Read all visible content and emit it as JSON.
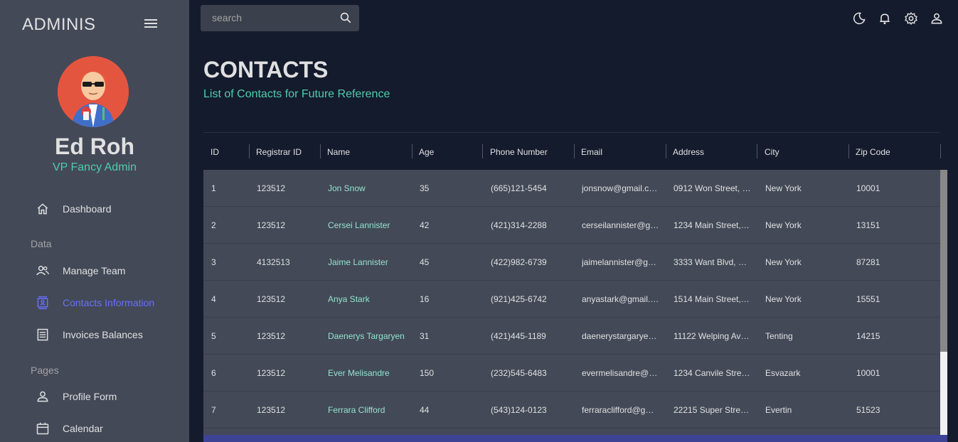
{
  "sidebar": {
    "brand": "ADMINIS",
    "user": {
      "name": "Ed Roh",
      "role": "VP Fancy Admin"
    },
    "items": [
      {
        "label": "Dashboard",
        "icon": "home-icon"
      },
      {
        "label": "Manage Team",
        "icon": "team-icon"
      },
      {
        "label": "Contacts Information",
        "icon": "contacts-icon",
        "active": true
      },
      {
        "label": "Invoices Balances",
        "icon": "receipt-icon"
      },
      {
        "label": "Profile Form",
        "icon": "person-icon"
      },
      {
        "label": "Calendar",
        "icon": "calendar-icon"
      }
    ],
    "sections": [
      "Data",
      "Pages"
    ]
  },
  "topbar": {
    "search_placeholder": "search",
    "icons": [
      "dark-mode-icon",
      "notifications-icon",
      "settings-icon",
      "user-icon"
    ]
  },
  "header": {
    "title": "CONTACTS",
    "subtitle": "List of Contacts for Future Reference"
  },
  "table": {
    "columns": [
      "ID",
      "Registrar ID",
      "Name",
      "Age",
      "Phone Number",
      "Email",
      "Address",
      "City",
      "Zip Code"
    ],
    "rows": [
      [
        "1",
        "123512",
        "Jon Snow",
        "35",
        "(665)121-5454",
        "jonsnow@gmail.c…",
        "0912 Won Street, …",
        "New York",
        "10001"
      ],
      [
        "2",
        "123512",
        "Cersei Lannister",
        "42",
        "(421)314-2288",
        "cerseilannister@g…",
        "1234 Main Street,…",
        "New York",
        "13151"
      ],
      [
        "3",
        "4132513",
        "Jaime Lannister",
        "45",
        "(422)982-6739",
        "jaimelannister@g…",
        "3333 Want Blvd, …",
        "New York",
        "87281"
      ],
      [
        "4",
        "123512",
        "Anya Stark",
        "16",
        "(921)425-6742",
        "anyastark@gmail.…",
        "1514 Main Street,…",
        "New York",
        "15551"
      ],
      [
        "5",
        "123512",
        "Daenerys Targaryen",
        "31",
        "(421)445-1189",
        "daenerystargarye…",
        "11122 Welping Av…",
        "Tenting",
        "14215"
      ],
      [
        "6",
        "123512",
        "Ever Melisandre",
        "150",
        "(232)545-6483",
        "evermelisandre@…",
        "1234 Canvile Stre…",
        "Esvazark",
        "10001"
      ],
      [
        "7",
        "123512",
        "Ferrara Clifford",
        "44",
        "(543)124-0123",
        "ferraraclifford@g…",
        "22215 Super Stre…",
        "Evertin",
        "51523"
      ]
    ]
  },
  "colors": {
    "background": "#141b2d",
    "sidebar": "#434957",
    "accent_green": "#4cceac",
    "accent_blue": "#6870fa",
    "footer": "#3e4396"
  }
}
